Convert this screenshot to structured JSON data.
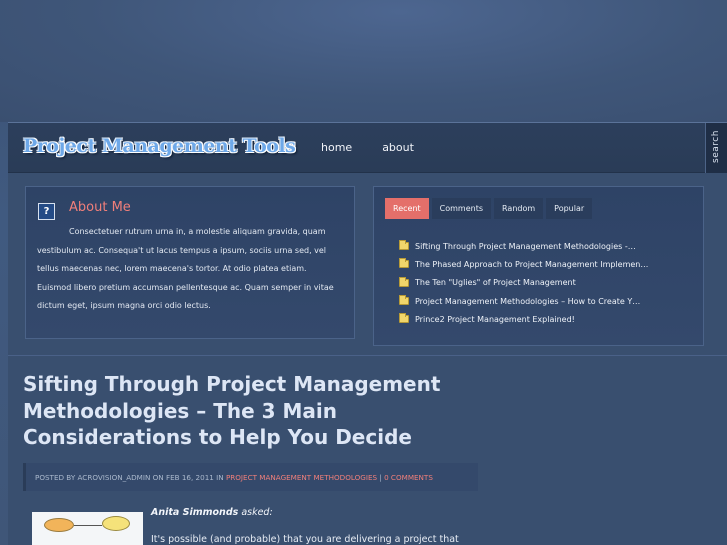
{
  "header": {
    "logo": "Project Management Tools",
    "nav": [
      "home",
      "about"
    ],
    "search_label": "search"
  },
  "about": {
    "title": "About Me",
    "icon": "question-icon",
    "text": "Consectetuer rutrum urna in, a molestie aliquam gravida, quam vestibulum ac. Consequa't ut lacus tempus a ipsum, sociis urna sed, vel tellus maecenas nec, lorem maecena's tortor. At odio platea etiam. Euismod libero pretium accumsan pellentesque ac. Quam semper in vitae dictum eget, ipsum magna orci odio lectus."
  },
  "tabs": {
    "items": [
      "Recent",
      "Comments",
      "Random",
      "Popular"
    ],
    "active": "Recent",
    "recent": [
      "Sifting Through Project Management Methodologies -…",
      "The Phased Approach to Project Management Implemen…",
      "The Ten \"Uglies\" of Project Management",
      "Project Management Methodologies – How to Create Y…",
      "Prince2 Project Management Explained!"
    ]
  },
  "post": {
    "title": "Sifting Through Project Management Methodologies – The 3 Main Considerations to Help You Decide",
    "meta_prefix": "Posted by Acrovision_admin on Feb 16, 2011 in",
    "category": "Project Management Methodologies",
    "separator": "|",
    "comments": "0 Comments",
    "asker_name": "Anita Simmonds",
    "asker_suffix": "asked:",
    "body_first_line": "It's possible (and probable) that you are delivering a project that"
  },
  "colors": {
    "accent": "#e46f6a",
    "background": "#3f5678",
    "logo": "#6ea8e8"
  }
}
